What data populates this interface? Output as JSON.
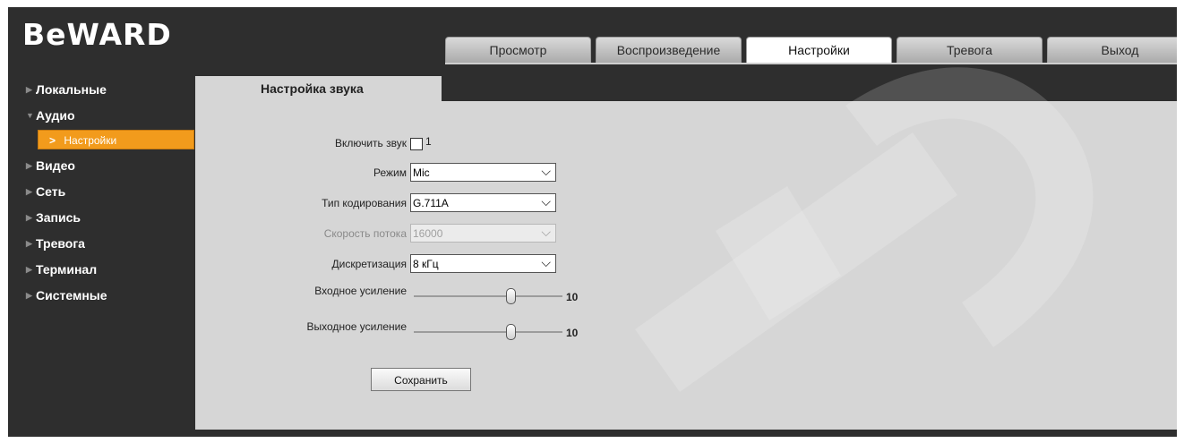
{
  "brand": {
    "logo": "BeWARD"
  },
  "nav": {
    "tabs": [
      {
        "label": "Просмотр",
        "active": false
      },
      {
        "label": "Воспроизведение",
        "active": false
      },
      {
        "label": "Настройки",
        "active": true
      },
      {
        "label": "Тревога",
        "active": false
      },
      {
        "label": "Выход",
        "active": false
      }
    ]
  },
  "sidebar": {
    "items": [
      {
        "label": "Локальные"
      },
      {
        "label": "Аудио",
        "expanded": true
      },
      {
        "label": "Видео"
      },
      {
        "label": "Сеть"
      },
      {
        "label": "Запись"
      },
      {
        "label": "Тревога"
      },
      {
        "label": "Терминал"
      },
      {
        "label": "Системные"
      }
    ],
    "active_subitem": "Настройки"
  },
  "content": {
    "tab_title": "Настройка звука",
    "enable_audio": {
      "label": "Включить звук",
      "checked": false,
      "suffix": "1"
    },
    "mode": {
      "label": "Режим",
      "value": "Mic"
    },
    "encoding": {
      "label": "Тип кодирования",
      "value": "G.711A"
    },
    "bitrate": {
      "label": "Скорость потока",
      "value": "16000",
      "disabled": true
    },
    "sampling": {
      "label": "Дискретизация",
      "value": "8 кГц"
    },
    "input_gain": {
      "label": "Входное усиление",
      "value": "10"
    },
    "output_gain": {
      "label": "Выходное усиление",
      "value": "10"
    },
    "save_label": "Сохранить"
  },
  "colors": {
    "accent": "#f29b1c",
    "background": "#2e2e2e",
    "panel": "#d6d6d6"
  }
}
